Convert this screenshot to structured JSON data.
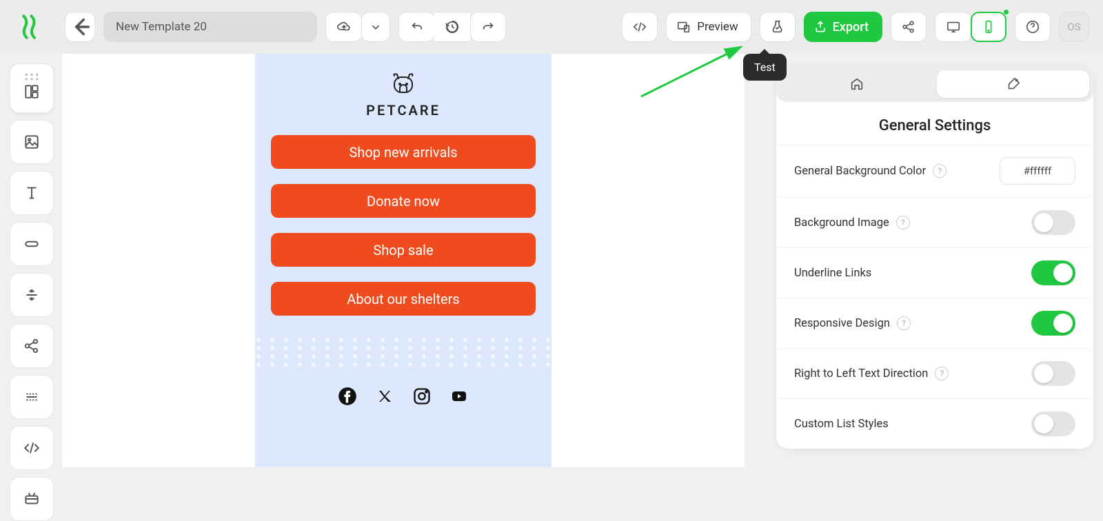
{
  "header": {
    "template_name": "New Template 20",
    "preview_label": "Preview",
    "export_label": "Export",
    "os_label": "OS",
    "tooltip_test": "Test"
  },
  "email": {
    "brand": "PETCARE",
    "buttons": [
      "Shop new arrivals",
      "Donate now",
      "Shop sale",
      "About our shelters"
    ]
  },
  "settings_panel": {
    "title": "General Settings",
    "rows": {
      "bg_color": {
        "label": "General Background Color",
        "value": "#ffffff"
      },
      "bg_image": {
        "label": "Background Image",
        "on": false
      },
      "underline": {
        "label": "Underline Links",
        "on": true
      },
      "responsive": {
        "label": "Responsive Design",
        "on": true
      },
      "rtl": {
        "label": "Right to Left Text Direction",
        "on": false
      },
      "list_styles": {
        "label": "Custom List Styles",
        "on": false
      }
    }
  }
}
